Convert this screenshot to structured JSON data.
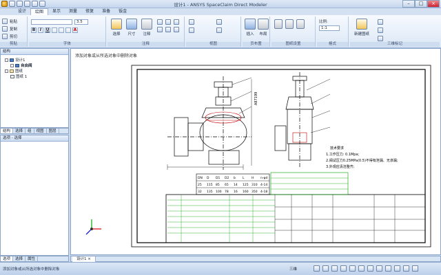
{
  "window": {
    "title": "设计1 - ANSYS SpaceClaim Direct Modeler",
    "controls": [
      "–",
      "□",
      "×"
    ]
  },
  "ribbon_tabs": [
    {
      "label": "设计",
      "active": false
    },
    {
      "label": "绘图",
      "active": true
    },
    {
      "label": "显示",
      "active": false
    },
    {
      "label": "测量",
      "active": false
    },
    {
      "label": "修复",
      "active": false
    },
    {
      "label": "准备",
      "active": false
    },
    {
      "label": "钣金",
      "active": false
    }
  ],
  "ribbon": {
    "clipboard": {
      "label": "剪贴",
      "paste": "粘贴",
      "copy": "复制",
      "cut": "剪切"
    },
    "font": {
      "label": "字体",
      "size": "3.5"
    },
    "insert_tools": {
      "select": "选择",
      "dimension": "尺寸",
      "annotation": "注释",
      "label": "注释"
    },
    "views": {
      "label": "视图"
    },
    "sheet": {
      "insert": "插入",
      "setup": "布局",
      "label": "页布置"
    },
    "sheet_setup": {
      "label": "图纸设置"
    },
    "scale": {
      "label": "比例:",
      "value": "1:1"
    },
    "formatting": {
      "label": "格式"
    },
    "drawing_ribbon": {
      "new_sheet": "新建图纸",
      "label": "三维标记"
    }
  },
  "structure_panel": {
    "title": "结构",
    "tree": [
      {
        "label": "设计1",
        "level": 0
      },
      {
        "label": "自由阀",
        "level": 1
      },
      {
        "label": "图纸",
        "level": 0
      },
      {
        "label": "图纸 1",
        "level": 1
      }
    ]
  },
  "structure_tabs": [
    "结构",
    "选择",
    "组",
    "视图",
    "图层"
  ],
  "options_panel": {
    "title": "选项 - 选择"
  },
  "bottom_tabs": [
    "选项",
    "选择",
    "属性"
  ],
  "canvas": {
    "hint": "添加对象或从所选对象中删除对象",
    "dimension_label": "A87199",
    "tech_requirements": [
      "技术要求",
      "1.工作压力: 0.1Mpa;",
      "2.阀试压力0.25MPa(0.5)不得有泄漏、无渗漏;",
      "3.外观应清洁整齐;"
    ],
    "param_table": {
      "headers": [
        "DN",
        "D",
        "D1",
        "D2",
        "b",
        "L",
        "H",
        "n-φd"
      ],
      "rows": [
        [
          "25",
          "115",
          "85",
          "65",
          "14",
          "125",
          "310",
          "4-14"
        ],
        [
          "32",
          "135",
          "100",
          "78",
          "16",
          "160",
          "350",
          "4-18"
        ]
      ]
    }
  },
  "document_tab": "设计1",
  "status": {
    "message": "添加对象或从所选对象中删除对象",
    "mode": "三维"
  }
}
